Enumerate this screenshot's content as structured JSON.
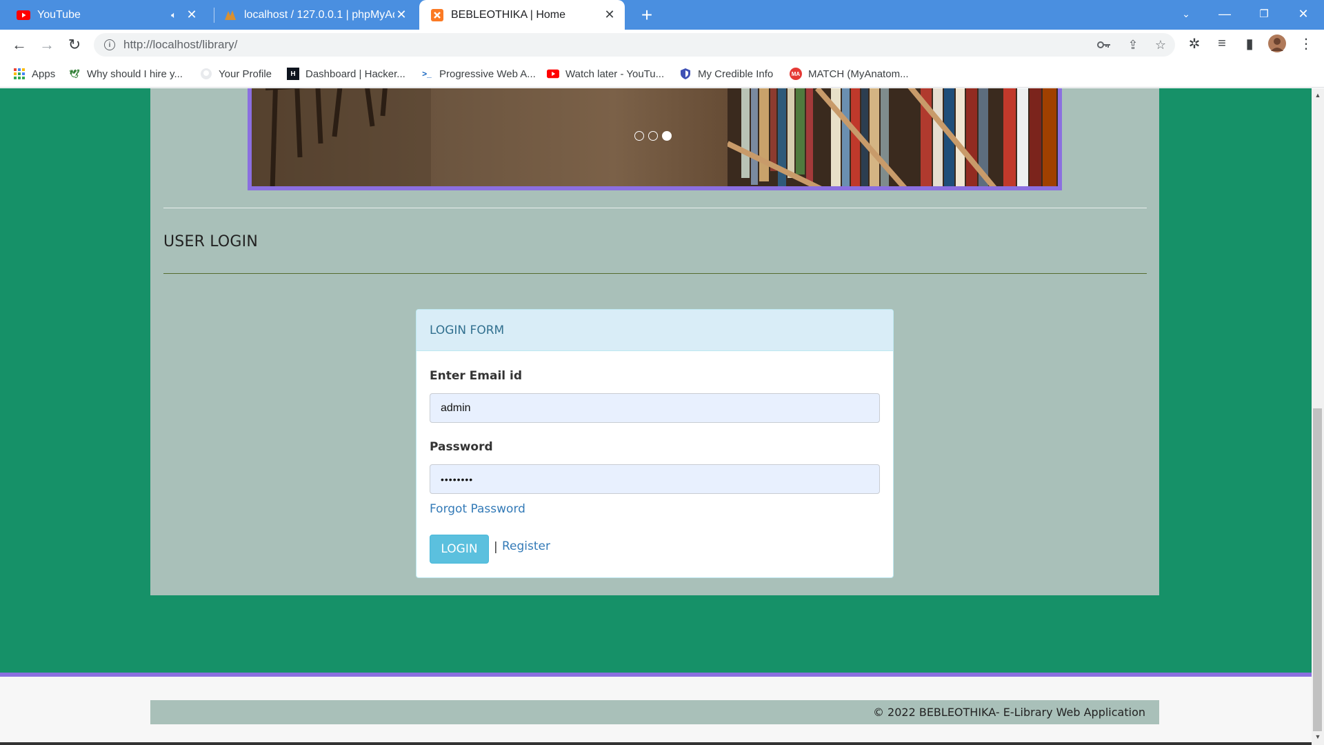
{
  "browser": {
    "tabs": [
      {
        "title": "YouTube",
        "icon": "youtube-icon",
        "muted": true,
        "active": false
      },
      {
        "title": "localhost / 127.0.0.1 | phpMyAdmin",
        "icon": "phpmyadmin-icon",
        "active": false
      },
      {
        "title": "BEBLEOTHIKA | Home",
        "icon": "xampp-icon",
        "active": true
      }
    ],
    "url": "http://localhost/library/",
    "bookmarks": [
      {
        "label": "Apps",
        "icon": "apps-grid-icon"
      },
      {
        "label": "Why should I hire y...",
        "icon": "bird-icon"
      },
      {
        "label": "Your Profile",
        "icon": "github-icon"
      },
      {
        "label": "Dashboard | Hacker...",
        "icon": "hackerrank-icon"
      },
      {
        "label": "Progressive Web A...",
        "icon": "terminal-icon"
      },
      {
        "label": "Watch later - YouTu...",
        "icon": "youtube-icon"
      },
      {
        "label": "My Credible Info",
        "icon": "shield-icon"
      },
      {
        "label": "MATCH (MyAnatom...",
        "icon": "ma-icon"
      }
    ]
  },
  "page": {
    "slider": {
      "slides": 3,
      "active_slide": 3
    },
    "section_title": "USER LOGIN",
    "login_form": {
      "heading": "LOGIN FORM",
      "email_label": "Enter Email id",
      "email_value": "admin",
      "password_label": "Password",
      "password_value": "••••••••",
      "forgot_link": "Forgot Password",
      "login_button": "LOGIN",
      "separator": "|",
      "register_link": "Register"
    },
    "footer_text": "© 2022 BEBLEOTHIKA- E-Library Web Application"
  },
  "colors": {
    "page_bg": "#169168",
    "container_bg": "#a9c0b9",
    "accent_purple": "#8b6fe0",
    "panel_heading_bg": "#d9edf7",
    "login_button": "#5bc0de",
    "link": "#337ab7"
  }
}
